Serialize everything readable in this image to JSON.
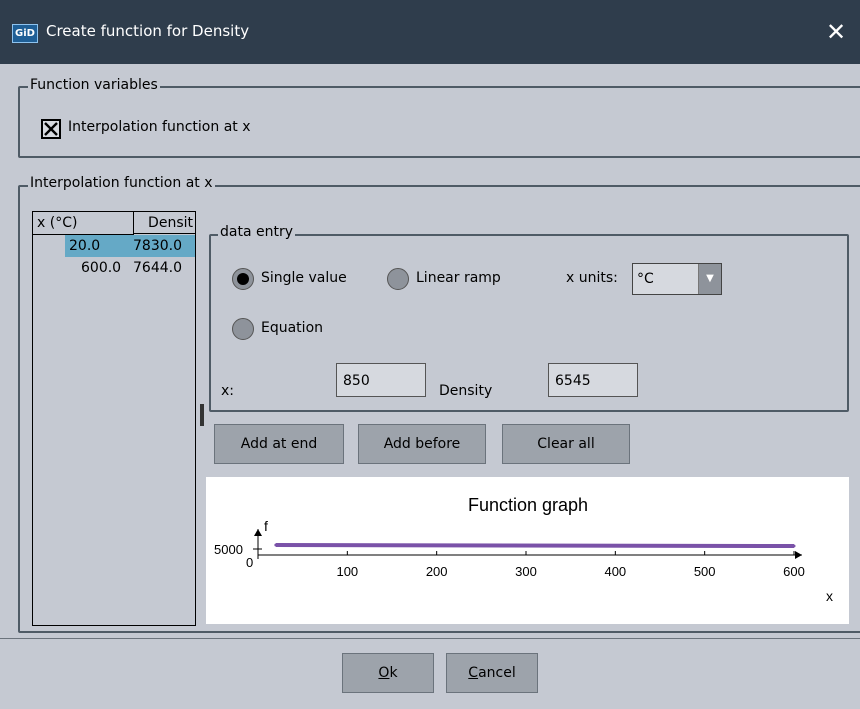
{
  "window": {
    "app_icon_text": "GiD",
    "title": "Create function for Density",
    "close_glyph": "✕"
  },
  "function_variables": {
    "legend": "Function variables",
    "checkbox_label": "Interpolation function at x",
    "checked": true
  },
  "interpolation": {
    "legend": "Interpolation function at x",
    "table": {
      "columns": [
        "x (°C)",
        "Densit"
      ],
      "rows": [
        {
          "x": "20.0",
          "value": "7830.0",
          "selected": true
        },
        {
          "x": "600.0",
          "value": "7644.0",
          "selected": false
        }
      ]
    },
    "data_entry": {
      "legend": "data entry",
      "mode_options": [
        "Single value",
        "Linear ramp",
        "Equation"
      ],
      "selected_mode": "Single value",
      "x_units_label": "x units:",
      "x_units_value": "°C",
      "x_label": "x:",
      "x_value": "850",
      "density_label": "Density",
      "density_value": "6545"
    },
    "buttons": {
      "add_at_end": "Add at end",
      "add_before": "Add before",
      "clear_all": "Clear all"
    }
  },
  "chart_data": {
    "type": "line",
    "title": "Function graph",
    "xlabel": "x",
    "ylabel": "f",
    "x_ticks": [
      "100",
      "200",
      "300",
      "400",
      "500",
      "600"
    ],
    "y_ticks": [
      "5000"
    ],
    "origin_label": "0",
    "xlim": [
      0,
      600
    ],
    "series": [
      {
        "x": [
          20,
          600
        ],
        "y": [
          7830,
          7644
        ],
        "color": "#7a52a8"
      }
    ]
  },
  "footer": {
    "ok_accel": "O",
    "ok_rest": "k",
    "cancel_accel": "C",
    "cancel_rest": "ancel"
  },
  "colors": {
    "titlebar": "#2f3d4c",
    "background": "#c5c9d2",
    "selection": "#65a9c6",
    "series": "#7a52a8"
  }
}
